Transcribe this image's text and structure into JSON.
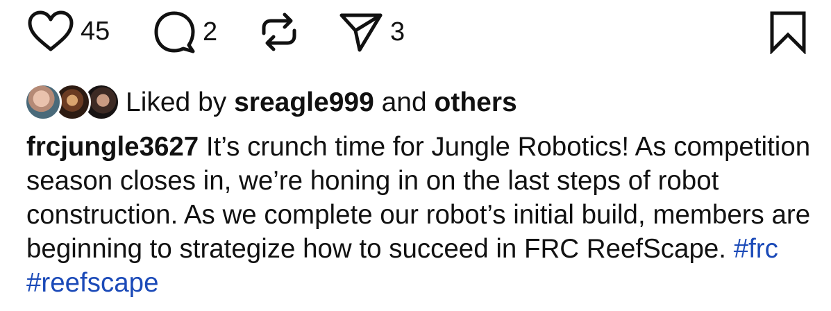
{
  "actions": {
    "like_icon": "heart-icon",
    "like_count": "45",
    "comment_icon": "speech-bubble-icon",
    "comment_count": "2",
    "repost_icon": "repost-arrows-icon",
    "share_icon": "paper-plane-icon",
    "share_count": "3",
    "save_icon": "bookmark-icon"
  },
  "liked_by": {
    "prefix": "Liked by ",
    "user": "sreagle999",
    "middle": " and ",
    "others": "others"
  },
  "caption": {
    "username": "frcjungle3627",
    "text": " It’s crunch time for Jungle Robotics! As competition season closes in, we’re honing in on the last steps of robot construction. As we complete our robot’s initial build, members are beginning to strategize how to succeed in FRC ReefScape. ",
    "hashtags": [
      "#frc",
      "#reefscape"
    ]
  },
  "colors": {
    "hashtag": "#1b4ab8",
    "text": "#111111",
    "background": "#ffffff"
  }
}
